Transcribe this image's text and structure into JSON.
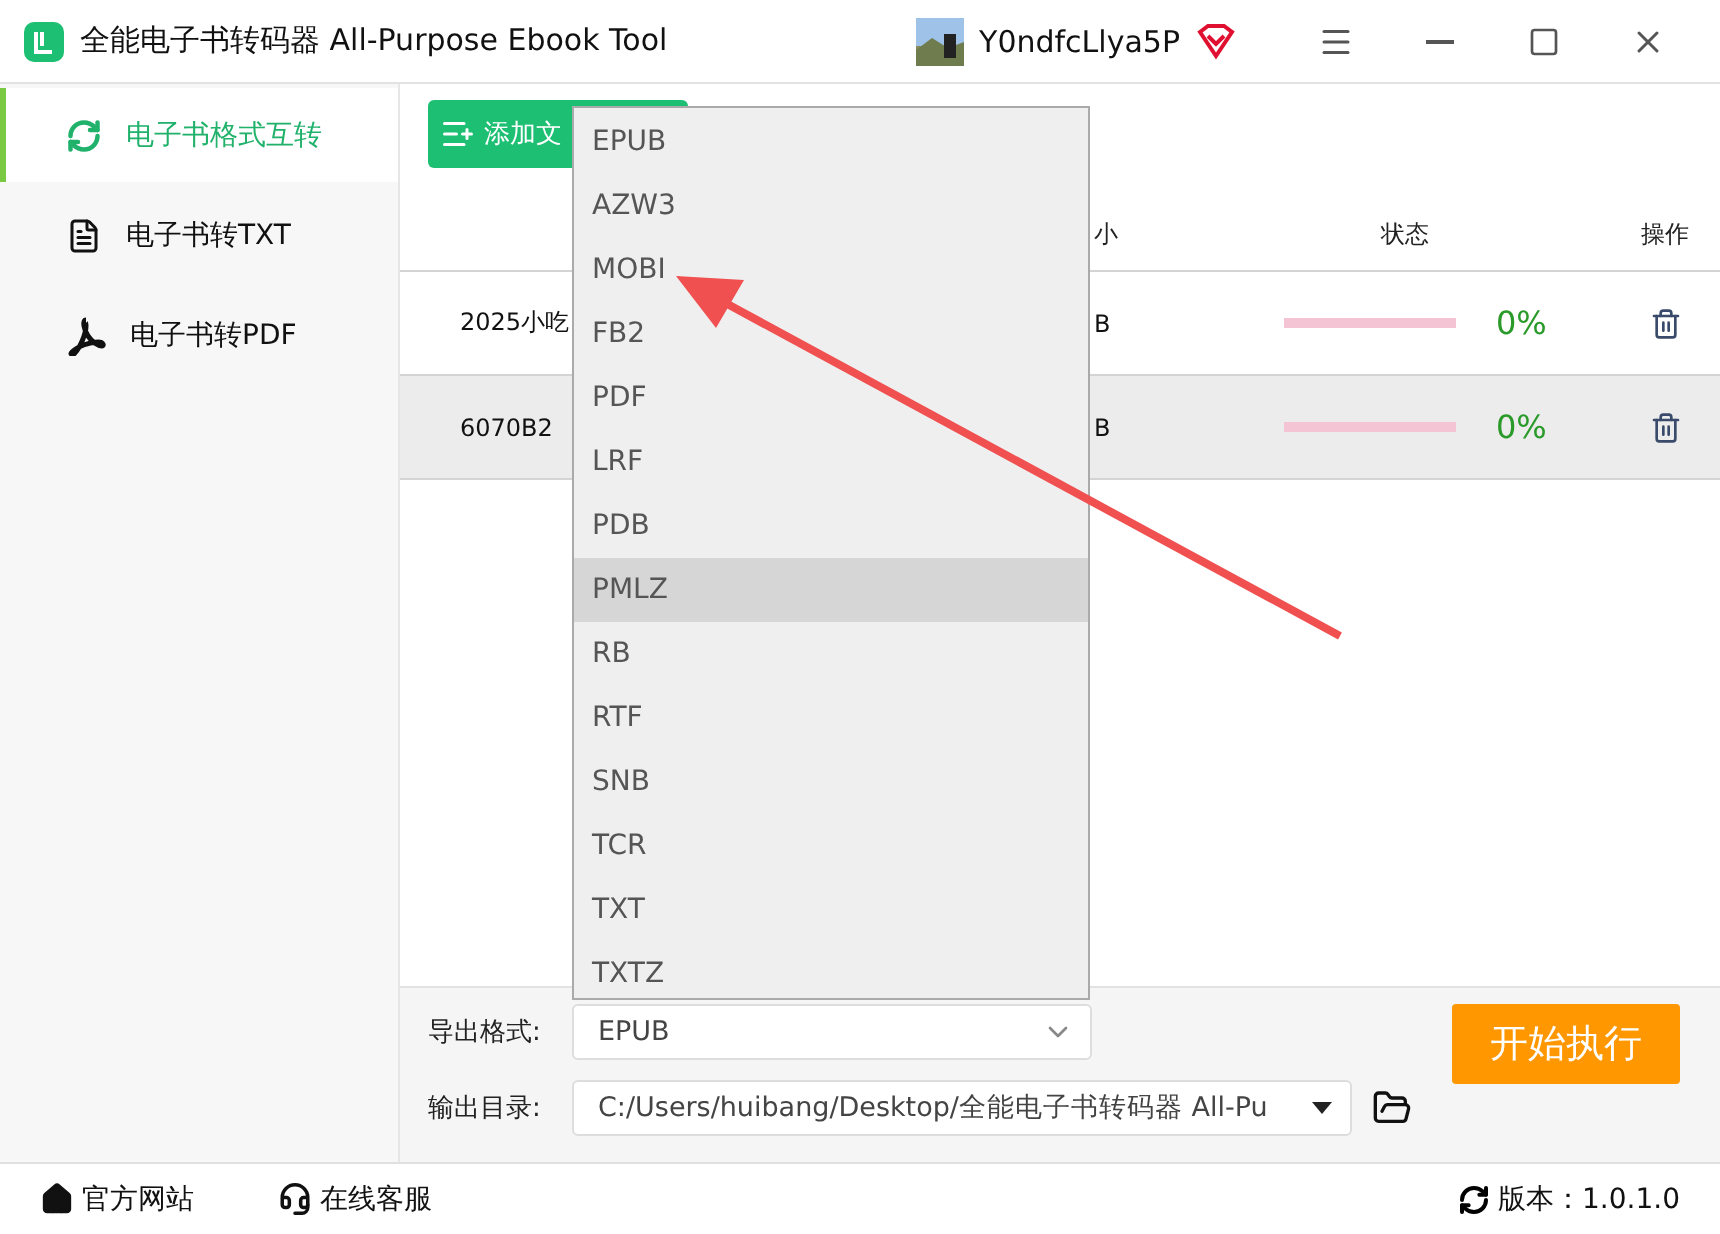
{
  "window": {
    "title": "全能电子书转码器 All-Purpose Ebook Tool",
    "user": "Y0ndfcLlya5P"
  },
  "sidebar": {
    "items": [
      {
        "label": "电子书格式互转",
        "selected": true
      },
      {
        "label": "电子书转TXT",
        "selected": false
      },
      {
        "label": "电子书转PDF",
        "selected": false
      }
    ]
  },
  "toolbar": {
    "add_button": "添加文"
  },
  "table": {
    "columns": [
      "小",
      "状态",
      "操作"
    ],
    "rows": [
      {
        "name": "2025小吃",
        "size": "B",
        "level": 0,
        "percent": "0%",
        "selected": false
      },
      {
        "name": "6070B2",
        "size": "B",
        "level": 0,
        "percent": "0%",
        "selected": true
      }
    ]
  },
  "dropdown": {
    "options": [
      {
        "label": "EPUB",
        "highlighted": false
      },
      {
        "label": "AZW3",
        "highlighted": false
      },
      {
        "label": "MOBI",
        "highlighted": false
      },
      {
        "label": "FB2",
        "highlighted": false
      },
      {
        "label": "PDF",
        "highlighted": false
      },
      {
        "label": "LRF",
        "highlighted": false
      },
      {
        "label": "PDB",
        "highlighted": false
      },
      {
        "label": "PMLZ",
        "highlighted": true
      },
      {
        "label": "RB",
        "highlighted": false
      },
      {
        "label": "RTF",
        "highlighted": false
      },
      {
        "label": "SNB",
        "highlighted": false
      },
      {
        "label": "TCR",
        "highlighted": false
      },
      {
        "label": "TXT",
        "highlighted": false
      },
      {
        "label": "TXTZ",
        "highlighted": false
      }
    ]
  },
  "export": {
    "format_label": "导出格式:",
    "format_value": "EPUB",
    "dir_label": "输出目录:",
    "dir_value": "C:/Users/huibang/Desktop/全能电子书转码器 All-Pu",
    "start_button": "开始执行"
  },
  "status_bar": {
    "links": [
      {
        "label": "官方网站"
      },
      {
        "label": "在线客服"
      }
    ],
    "version": "版本：1.0.1.0"
  }
}
